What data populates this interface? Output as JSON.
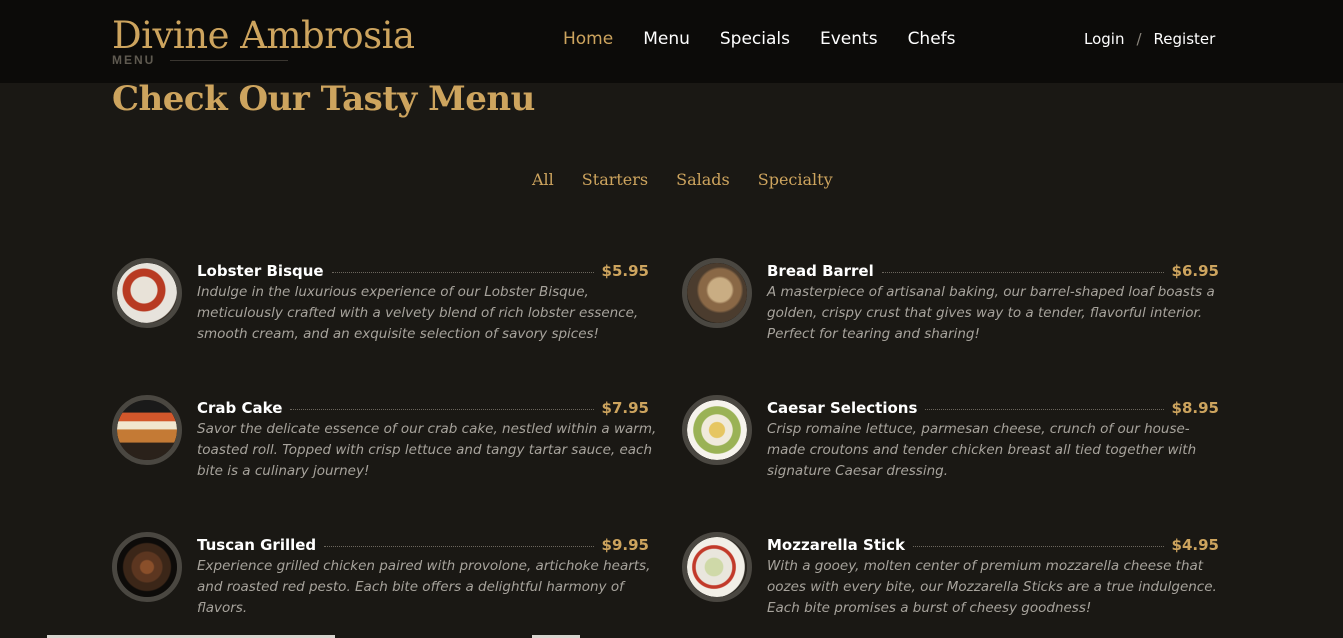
{
  "brand": {
    "name": "Divine Ambrosia",
    "sub": "MENU",
    "accent_color": "#cda45e"
  },
  "nav": {
    "items": [
      "Home",
      "Menu",
      "Specials",
      "Events",
      "Chefs"
    ],
    "active": "Home"
  },
  "auth": {
    "login": "Login",
    "separator": "/",
    "register": "Register"
  },
  "section": {
    "title": "Check Our Tasty Menu"
  },
  "filters": [
    "All",
    "Starters",
    "Salads",
    "Specialty"
  ],
  "items": [
    {
      "name": "Lobster Bisque",
      "price": "$5.95",
      "description": "Indulge in the luxurious experience of our Lobster Bisque, meticulously crafted with a velvety blend of rich lobster essence, smooth cream, and an exquisite selection of savory spices!",
      "image_icon": "lobster-dish-icon"
    },
    {
      "name": "Bread Barrel",
      "price": "$6.95",
      "description": "A masterpiece of artisanal baking, our barrel-shaped loaf boasts a golden, crispy crust that gives way to a tender, flavorful interior. Perfect for tearing and sharing!",
      "image_icon": "bread-dish-icon"
    },
    {
      "name": "Crab Cake",
      "price": "$7.95",
      "description": "Savor the delicate essence of our crab cake, nestled within a warm, toasted roll. Topped with crisp lettuce and tangy tartar sauce, each bite is a culinary journey!",
      "image_icon": "crab-cake-icon"
    },
    {
      "name": "Caesar Selections",
      "price": "$8.95",
      "description": "Crisp romaine lettuce, parmesan cheese, crunch of our house-made croutons and tender chicken breast all tied together with signature Caesar dressing.",
      "image_icon": "salad-dish-icon"
    },
    {
      "name": "Tuscan Grilled",
      "price": "$9.95",
      "description": "Experience grilled chicken paired with provolone, artichoke hearts, and roasted red pesto. Each bite offers a delightful harmony of flavors.",
      "image_icon": "grilled-dish-icon"
    },
    {
      "name": "Mozzarella Stick",
      "price": "$4.95",
      "description": "With a gooey, molten center of premium mozzarella cheese that oozes with every bite, our Mozzarella Sticks are a true indulgence. Each bite promises a burst of cheesy goodness!",
      "image_icon": "mozzarella-dish-icon"
    }
  ]
}
